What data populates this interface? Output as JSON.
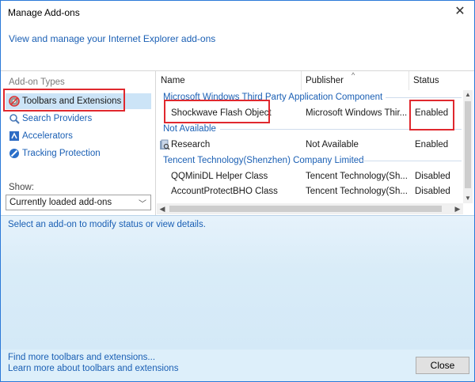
{
  "window": {
    "title": "Manage Add-ons",
    "close_glyph": "✕",
    "header_link": "View and manage your Internet Explorer add-ons"
  },
  "sidebar": {
    "types_label": "Add-on Types",
    "items": [
      {
        "label": "Toolbars and Extensions",
        "icon": "gear-blocked-icon",
        "selected": true
      },
      {
        "label": "Search Providers",
        "icon": "search-icon",
        "selected": false
      },
      {
        "label": "Accelerators",
        "icon": "accelerator-icon",
        "selected": false
      },
      {
        "label": "Tracking Protection",
        "icon": "tracking-protection-icon",
        "selected": false
      }
    ],
    "show_label": "Show:",
    "show_value": "Currently loaded add-ons"
  },
  "list": {
    "columns": [
      "Name",
      "Publisher",
      "Status"
    ],
    "sort_glyph": "^",
    "groups": [
      {
        "name": "Microsoft Windows Third Party Application Component",
        "rows": [
          {
            "name": "Shockwave Flash Object",
            "publisher": "Microsoft Windows Thir...",
            "status": "Enabled"
          }
        ]
      },
      {
        "name": "Not Available",
        "rows": [
          {
            "name": "Research",
            "publisher": "Not Available",
            "status": "Enabled"
          }
        ]
      },
      {
        "name": "Tencent Technology(Shenzhen) Company Limited",
        "rows": [
          {
            "name": "QQMiniDL Helper Class",
            "publisher": "Tencent Technology(Sh...",
            "status": "Disabled"
          },
          {
            "name": "AccountProtectBHO Class",
            "publisher": "Tencent Technology(Sh...",
            "status": "Disabled"
          }
        ]
      }
    ]
  },
  "details": {
    "message": "Select an add-on to modify status or view details."
  },
  "footer": {
    "link1": "Find more toolbars and extensions...",
    "link2": "Learn more about toolbars and extensions",
    "close_button": "Close"
  },
  "colors": {
    "highlight": "#e0282e",
    "link": "#1a5fb4",
    "selection": "#cce4f7",
    "details_bg": "#d9ecf8"
  }
}
